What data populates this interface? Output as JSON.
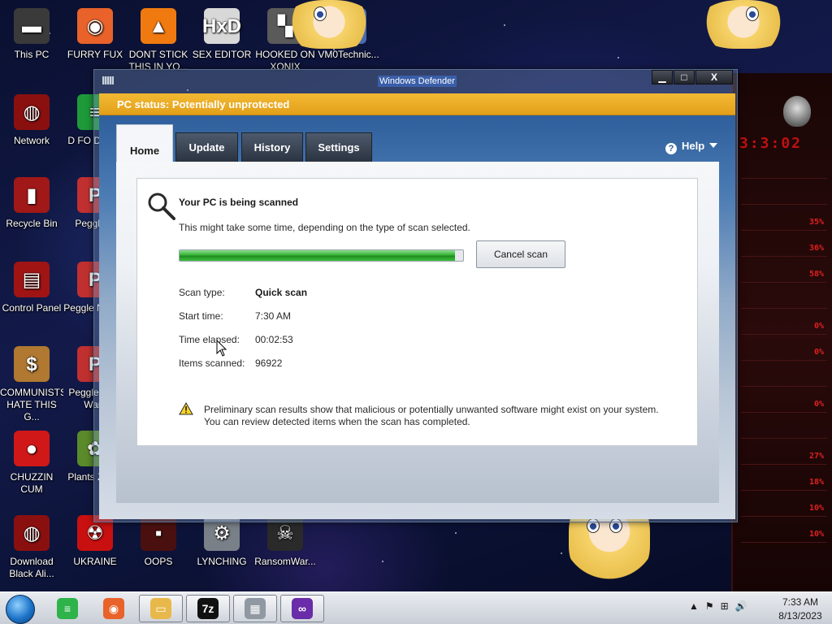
{
  "desktop": {
    "icons": [
      {
        "label": "This PC",
        "icon": "this-pc-icon",
        "color": "#3a3a3a",
        "glyph": "▬"
      },
      {
        "label": "FURRY FUX",
        "icon": "firefox-icon",
        "color": "#e8622a",
        "glyph": "◉"
      },
      {
        "label": "DONT STICK THIS IN YO...",
        "icon": "vlc-cone-icon",
        "color": "#f07a10",
        "glyph": "▲"
      },
      {
        "label": "SEX EDITOR",
        "icon": "hxd-icon",
        "color": "#d8d8d8",
        "glyph": "HxD"
      },
      {
        "label": "HOOKED ON XONIX",
        "icon": "xonix-icon",
        "color": "#5a5a5a",
        "glyph": "▚"
      },
      {
        "label": "VM0Technic...",
        "icon": "vm-icon",
        "color": "#4a6ab0",
        "glyph": "▣"
      },
      {
        "label": "Network",
        "icon": "network-icon",
        "color": "#8a1010",
        "glyph": "◍"
      },
      {
        "label": "D FO DUMB",
        "icon": "file-icon",
        "color": "#1e9a3a",
        "glyph": "≡"
      },
      {
        "label": "Recycle Bin",
        "icon": "recycle-bin-icon",
        "color": "#a01818",
        "glyph": "▮"
      },
      {
        "label": "Peggle D",
        "icon": "peggle-icon",
        "color": "#c03030",
        "glyph": "P"
      },
      {
        "label": "Control Panel",
        "icon": "control-panel-icon",
        "color": "#a01414",
        "glyph": "▤"
      },
      {
        "label": "Peggle N Delu",
        "icon": "peggle-nights-icon",
        "color": "#c03030",
        "glyph": "P"
      },
      {
        "label": "COMMUNISTS HATE THIS G...",
        "icon": "money-bag-icon",
        "color": "#b07830",
        "glyph": "$"
      },
      {
        "label": "Peggle W of Warc",
        "icon": "peggle-wow-icon",
        "color": "#c03030",
        "glyph": "P"
      },
      {
        "label": "CHUZZIN CUM",
        "icon": "chuzzle-icon",
        "color": "#d01818",
        "glyph": "●"
      },
      {
        "label": "Plants Zomb",
        "icon": "plants-icon",
        "color": "#5a8a2a",
        "glyph": "✿"
      },
      {
        "label": "Download Black Ali...",
        "icon": "alien-icon",
        "color": "#8a1010",
        "glyph": "◍"
      },
      {
        "label": "UKRAINE",
        "icon": "radiation-icon",
        "color": "#c81010",
        "glyph": "☢"
      },
      {
        "label": "OOPS",
        "icon": "oops-icon",
        "color": "#4a1010",
        "glyph": "▪"
      },
      {
        "label": "LYNCHING",
        "icon": "gear-skull-icon",
        "color": "#7a8088",
        "glyph": "⚙"
      },
      {
        "label": "RansomWar...",
        "icon": "skull-icon",
        "color": "#2a2a2a",
        "glyph": "☠"
      }
    ]
  },
  "gadget": {
    "clock": "3:3:02",
    "rows": [
      "",
      "",
      "35%",
      "36%",
      "58%",
      "",
      "0%",
      "0%",
      "",
      "0%",
      "",
      "27%",
      "18%",
      "10%",
      "10%"
    ]
  },
  "window": {
    "title": "Windows Defender",
    "controls": {
      "minimize": "▁",
      "maximize": "□",
      "close": "X"
    },
    "status_bar": "PC status: Potentially unprotected",
    "status_color": "#f0b22a",
    "tabs": [
      "Home",
      "Update",
      "History",
      "Settings"
    ],
    "active_tab": "Home",
    "help_label": "Help",
    "scan": {
      "heading": "Your PC is being scanned",
      "subtext": "This might take some time, depending on the type of scan selected.",
      "progress_fraction": 0.97,
      "cancel_label": "Cancel scan",
      "details": [
        {
          "label": "Scan type:",
          "value": "Quick scan",
          "bold": true
        },
        {
          "label": "Start time:",
          "value": "7:30 AM",
          "bold": false
        },
        {
          "label": "Time elapsed:",
          "value": "00:02:53",
          "bold": false
        },
        {
          "label": "Items scanned:",
          "value": "96922",
          "bold": false
        }
      ],
      "warning_line1": "Preliminary scan results show that malicious or potentially unwanted software might exist on your system.",
      "warning_line2": "You can review detected items when the scan has completed."
    }
  },
  "taskbar": {
    "buttons": [
      {
        "name": "taskbar-green-app",
        "icon": "green-doc-icon",
        "color": "#2db34a",
        "glyph": "≡"
      },
      {
        "name": "taskbar-firefox",
        "icon": "firefox-icon",
        "color": "#e8622a",
        "glyph": "◉"
      },
      {
        "name": "taskbar-explorer",
        "icon": "folder-icon",
        "color": "#e8b84a",
        "glyph": "▭"
      },
      {
        "name": "taskbar-7zip",
        "icon": "7zip-icon",
        "color": "#111111",
        "glyph": "7z"
      },
      {
        "name": "taskbar-firewall",
        "icon": "brick-wall-icon",
        "color": "#9098a2",
        "glyph": "▦"
      },
      {
        "name": "taskbar-purple-app",
        "icon": "mask-icon",
        "color": "#6a2ca8",
        "glyph": "∞"
      }
    ],
    "tray_icons": [
      "▲",
      "⚑",
      "⊞",
      "🔊"
    ],
    "time": "7:33 AM",
    "date": "8/13/2023"
  }
}
